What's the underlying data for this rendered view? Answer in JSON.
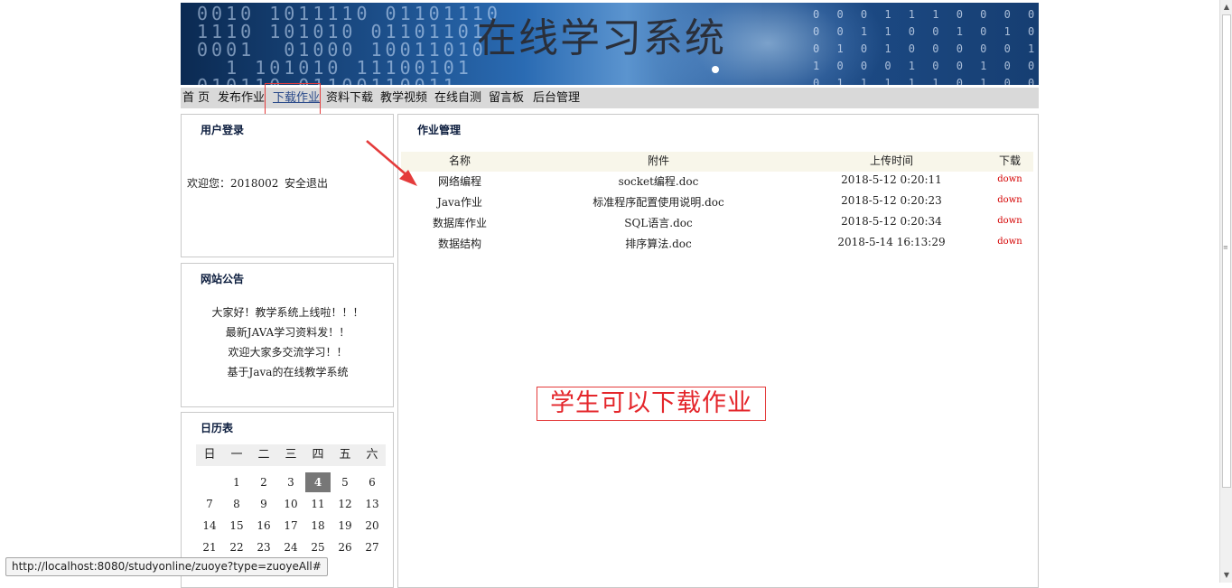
{
  "banner": {
    "title": "在线学习系统"
  },
  "nav": {
    "items": [
      "首 页",
      "发布作业",
      "下载作业",
      "资料下载",
      "教学视频",
      "在线自测",
      "留言板",
      "后台管理"
    ],
    "active": "下载作业"
  },
  "login": {
    "title": "用户登录",
    "welcome": "欢迎您：2018002",
    "logout": "安全退出"
  },
  "notice": {
    "title": "网站公告",
    "lines": [
      "大家好！教学系统上线啦！！！",
      "最新JAVA学习资料发！！",
      "欢迎大家多交流学习！！",
      "基于Java的在线教学系统"
    ]
  },
  "calendar": {
    "title": "日历表",
    "weekdays": [
      "日",
      "一",
      "二",
      "三",
      "四",
      "五",
      "六"
    ],
    "rows": [
      [
        "",
        "1",
        "2",
        "3",
        "4",
        "5",
        "6"
      ],
      [
        "7",
        "8",
        "9",
        "10",
        "11",
        "12",
        "13"
      ],
      [
        "14",
        "15",
        "16",
        "17",
        "18",
        "19",
        "20"
      ],
      [
        "21",
        "22",
        "23",
        "24",
        "25",
        "26",
        "27"
      ]
    ],
    "today": "4"
  },
  "homework": {
    "title": "作业管理",
    "headers": [
      "名称",
      "附件",
      "上传时间",
      "下载"
    ],
    "rows": [
      {
        "name": "网络编程",
        "file": "socket编程.doc",
        "time": "2018-5-12 0:20:11",
        "link": "down"
      },
      {
        "name": "Java作业",
        "file": "标准程序配置使用说明.doc",
        "time": "2018-5-12 0:20:23",
        "link": "down"
      },
      {
        "name": "数据库作业",
        "file": "SQL语言.doc",
        "time": "2018-5-12 0:20:34",
        "link": "down"
      },
      {
        "name": "数据结构",
        "file": "排序算法.doc",
        "time": "2018-5-14 16:13:29",
        "link": "down"
      }
    ]
  },
  "annotation": {
    "callout": "学生可以下载作业",
    "color": "#e43b3b"
  },
  "status_url": "http://localhost:8080/studyonline/zuoye?type=zuoyeAll#"
}
